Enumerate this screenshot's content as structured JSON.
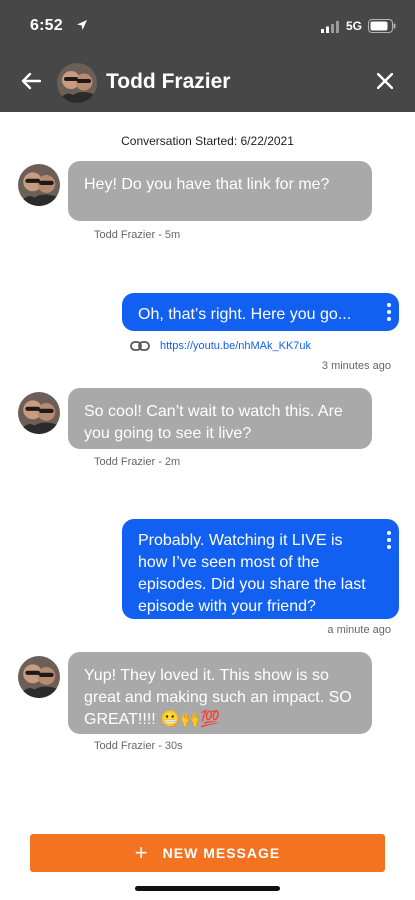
{
  "status_bar": {
    "time": "6:52",
    "network": "5G"
  },
  "header": {
    "contact_name": "Todd Frazier"
  },
  "conversation": {
    "started_label": "Conversation Started: 6/22/2021",
    "messages": [
      {
        "direction": "in",
        "text": "Hey!  Do you have that link for me?",
        "meta": "Todd Frazier - 5m"
      },
      {
        "direction": "out",
        "text": "Oh, that’s right. Here you go...",
        "link": "https://youtu.be/nhMAk_KK7uk",
        "meta": "3 minutes ago"
      },
      {
        "direction": "in",
        "text": "So cool!  Can’t wait to watch this. Are you going to see it live?",
        "meta": "Todd Frazier - 2m"
      },
      {
        "direction": "out",
        "text": "Probably. Watching it LIVE is how I’ve seen most of the episodes. Did you share the last episode with your friend?",
        "meta": "a minute ago"
      },
      {
        "direction": "in",
        "text": "Yup!  They loved it. This show is so great and making such an impact. SO GREAT!!!! 😬🙌💯",
        "meta": "Todd Frazier - 30s"
      }
    ]
  },
  "footer": {
    "new_message_label": "NEW MESSAGE"
  },
  "colors": {
    "header_bg": "#474747",
    "incoming_bubble": "#a9a9a9",
    "outgoing_bubble": "#1160f2",
    "accent_button": "#f37321"
  },
  "icons": [
    "location-arrow-icon",
    "signal-icon",
    "battery-icon",
    "back-arrow-icon",
    "close-icon",
    "kebab-menu-icon",
    "link-icon",
    "plus-icon"
  ]
}
